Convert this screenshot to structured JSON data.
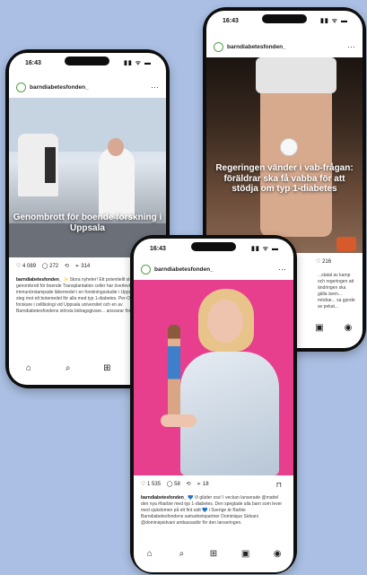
{
  "phones": {
    "left": {
      "time": "16:43",
      "status_icons": "▮▮ ᯤ ▬",
      "account": "barndiabetesfonden_",
      "more": "⋯",
      "overlay": "Genombrott för boende forskning i Uppsala",
      "likes": "♡ 4 089",
      "comments": "◯ 272",
      "reposts": "⟲",
      "shares": "➢ 314",
      "bookmark": "⊓",
      "caption_user": "barndiabetesfonden_",
      "caption_text": " ✨ Stora nyheter! Ett potentiellt stort genombrott för boende Transplantation celler har överlevt i en stort immunörstampade läkemedel i en forskningsstudie i Uppsala. Det är ett steg mot ett botemedel för alla med typ 1-diabetes. Per-Ola Carlsson, forskare i cellbiologi vid Uppsala universitet och en av Barndiabetesfondens största bidragsgivare... ansvarar för studien.",
      "nav": [
        "⌂",
        "⌕",
        "⊞",
        "▣"
      ]
    },
    "right": {
      "time": "16:43",
      "status_icons": "▮▮ ᯤ ▬",
      "account": "barndiabetesfonden_",
      "more": "⋯",
      "overlay": "Regeringen vänder i vab-frågan: föräldrar ska få vabba för att stödja om typ 1-diabetes",
      "likes": "♡ 216",
      "caption_text": "...statal av kamp och regeringen att ändringen ska gälla även... mödrar... sa gjorde av pekat...",
      "nav": [
        "▣",
        "◉"
      ]
    },
    "front": {
      "time": "16:43",
      "status_icons": "▮▮ ᯤ ▬",
      "account": "barndiabetesfonden_",
      "more": "⋯",
      "likes": "♡ 1 535",
      "comments": "◯ 58",
      "reposts": "⟲",
      "shares": "➢ 18",
      "bookmark": "⊓",
      "caption_user": "barndiabetesfonden_",
      "caption_text": " 💙 Vi gläder oss! I veckan lanserade @mattel den nya #barbie med typ 1-diabetes. Den speglade alla barn som lever med sjukdomen på ett fint sätt 💙 i Sverige är Barbie Barndiabetesfondens samarbetspartner Dominique Sidvani @dominiqsidvani ambassadör för den lanseringen.",
      "nav": [
        "⌂",
        "⌕",
        "⊞",
        "▣",
        "◉"
      ]
    }
  },
  "colors": {
    "background": "#aabfe3",
    "pink": "#e73f8e",
    "link": "#3f6fb8"
  }
}
